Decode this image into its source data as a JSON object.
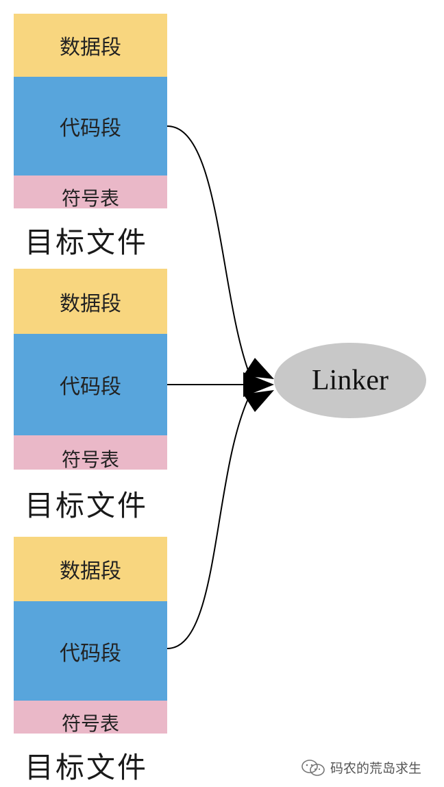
{
  "object_files": [
    {
      "data_segment": "数据段",
      "code_segment": "代码段",
      "symbol_table": "符号表",
      "label": "目标文件"
    },
    {
      "data_segment": "数据段",
      "code_segment": "代码段",
      "symbol_table": "符号表",
      "label": "目标文件"
    },
    {
      "data_segment": "数据段",
      "code_segment": "代码段",
      "symbol_table": "符号表",
      "label": "目标文件"
    }
  ],
  "linker": {
    "label": "Linker",
    "color": "#c8c8c8"
  },
  "colors": {
    "data_segment": "#f8d67f",
    "code_segment": "#58a5dc",
    "symbol_table": "#eab8c8"
  },
  "watermark": {
    "text": "码农的荒岛求生",
    "icon": "wechat-icon"
  }
}
